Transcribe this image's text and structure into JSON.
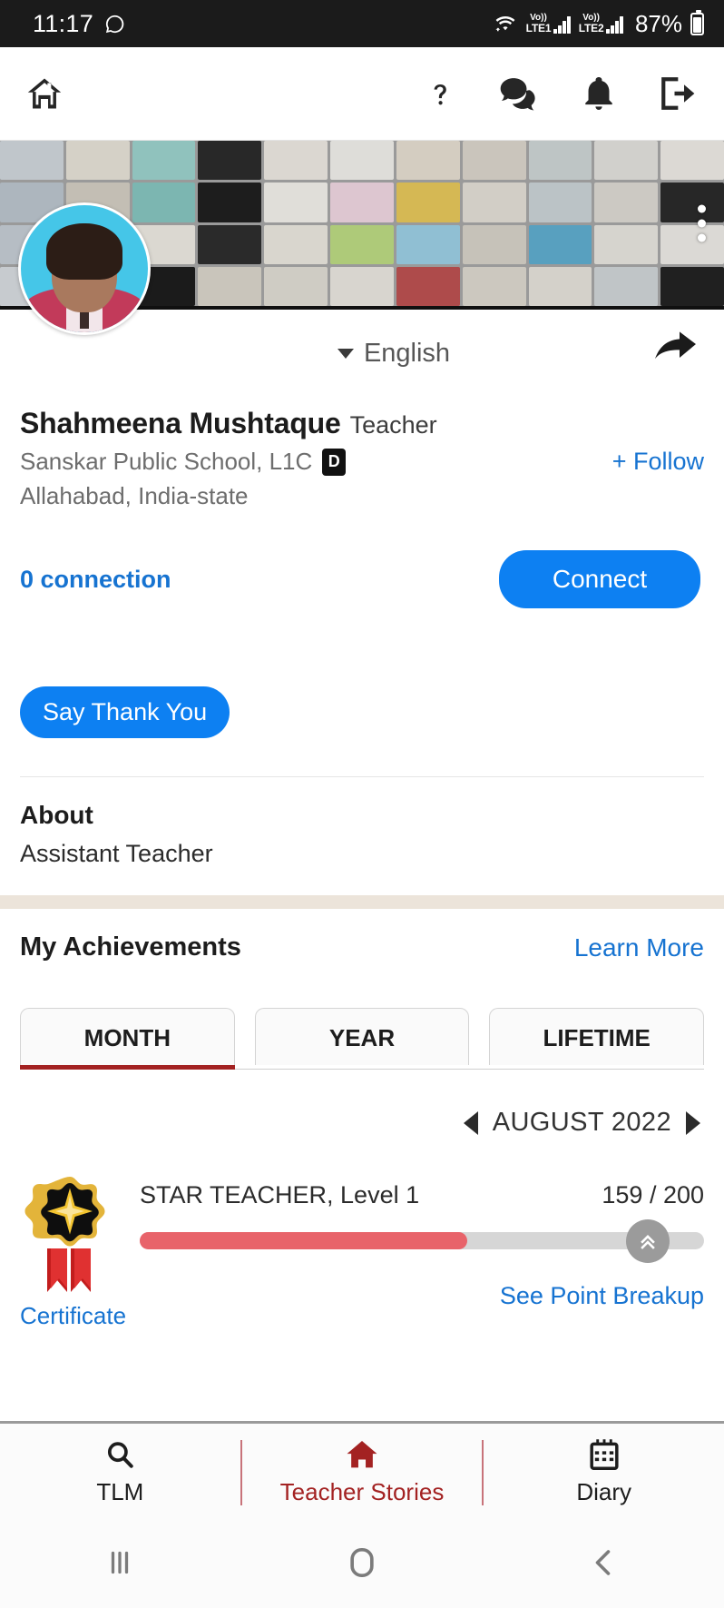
{
  "status_bar": {
    "time": "11:17",
    "whatsapp_icon": "whatsapp-icon",
    "wifi_icon": "wifi-icon",
    "volte1_label": "Vo))",
    "lte1_label": "LTE1",
    "volte2_label": "Vo))",
    "lte2_label": "LTE2",
    "battery_percent": "87%"
  },
  "app_bar": {
    "home_icon": "home-icon",
    "help_icon": "question-mark-icon",
    "chat_icon": "chat-bubbles-icon",
    "notifications_icon": "bell-icon",
    "logout_icon": "logout-icon"
  },
  "cover": {
    "options_icon": "kebab-menu-icon"
  },
  "profile": {
    "language": "English",
    "language_caret_icon": "chevron-down-icon",
    "share_icon": "share-arrow-icon",
    "avatar": "profile-avatar",
    "name": "Shahmeena Mushtaque",
    "role": "Teacher",
    "school": "Sanskar Public School, L1C",
    "school_badge": "D",
    "follow_label": "+ Follow",
    "location": "Allahabad, India-state",
    "connections": "0 connection",
    "connect_label": "Connect",
    "thanks_label": "Say Thank You"
  },
  "about": {
    "heading": "About",
    "text": "Assistant Teacher"
  },
  "achievements": {
    "title": "My Achievements",
    "learn_more": "Learn More",
    "tabs": [
      {
        "label": "MONTH",
        "active": true
      },
      {
        "label": "YEAR",
        "active": false
      },
      {
        "label": "LIFETIME",
        "active": false
      }
    ],
    "prev_icon": "left-triangle-icon",
    "next_icon": "right-triangle-icon",
    "period": "AUGUST 2022",
    "badge_icon": "star-medal-icon",
    "certificate_label": "Certificate",
    "level_title": "STAR TEACHER, Level 1",
    "points": "159 / 200",
    "progress_percent": 58,
    "progress_fill_color": "#e8636a",
    "level_up_icon": "double-chevron-up-icon",
    "breakup_label": "See Point Breakup",
    "accent_color": "#a32222"
  },
  "bottom_nav": {
    "items": [
      {
        "label": "TLM",
        "icon": "search-icon",
        "active": false
      },
      {
        "label": "Teacher Stories",
        "icon": "home-icon",
        "active": true
      },
      {
        "label": "Diary",
        "icon": "calendar-icon",
        "active": false
      }
    ]
  },
  "system_nav": {
    "recents_icon": "recents-icon",
    "home_icon": "home-circle-icon",
    "back_icon": "back-chevron-icon"
  }
}
